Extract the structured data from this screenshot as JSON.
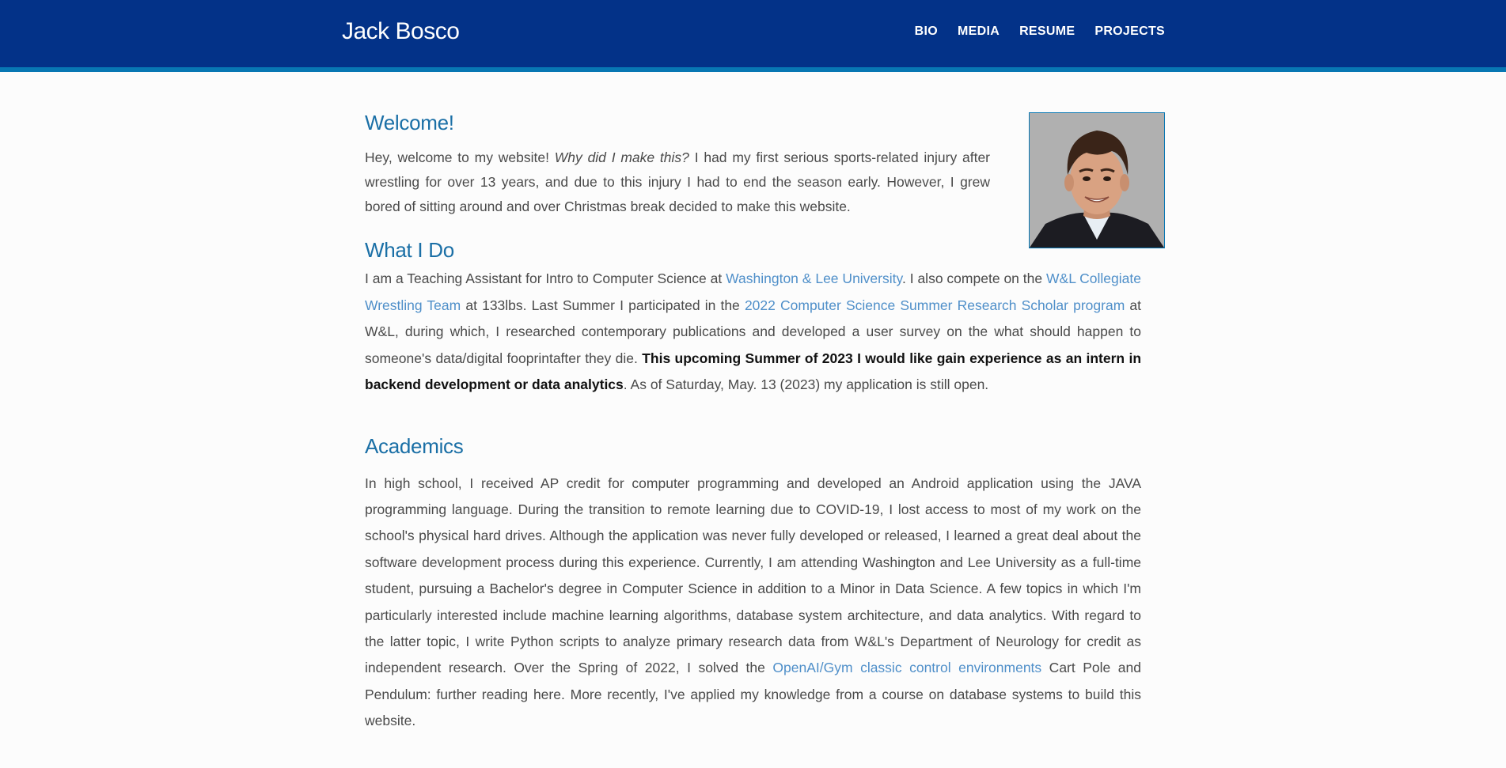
{
  "header": {
    "brand": "Jack Bosco",
    "nav": [
      "BIO",
      "MEDIA",
      "RESUME",
      "PROJECTS"
    ]
  },
  "welcome": {
    "title": "Welcome!",
    "text_1": "Hey, welcome to my website! ",
    "text_em": "Why did I make this?",
    "text_2": " I had my first serious sports-related injury after wrestling for over 13 years, and due to this injury I had to end the season early. However, I grew bored of sitting around and over Christmas break decided to make this website."
  },
  "what_i_do": {
    "title": "What I Do",
    "t1": "I am a Teaching Assistant for Intro to Computer Science at ",
    "link_wlu": "Washington & Lee University",
    "t2": ". I also compete on the ",
    "link_wrestling": "W&L Collegiate Wrestling Team",
    "t3": " at 133lbs. Last Summer I participated in the ",
    "link_research": "2022 Computer Science Summer Research Scholar program",
    "t4": " at W&L, during which, I researched contemporary publications and developed a user survey on the what should happen to someone's data/digital fooprintafter they die. ",
    "bold": "This upcoming Summer of 2023 I would like gain experience as an intern in backend development or data analytics",
    "t5": ". As of Saturday, May. 13 (2023) my application is still open."
  },
  "academics": {
    "title": "Academics",
    "t1": "In high school, I received AP credit for computer programming and developed an Android application using the JAVA programming language. During the transition to remote learning due to COVID-19, I lost access to most of my work on the school's physical hard drives. Although the application was never fully developed or released, I learned a great deal about the software development process during this experience. Currently, I am attending Washington and Lee University as a full-time student, pursuing a Bachelor's degree in Computer Science in addition to a Minor in Data Science. A few topics in which I'm particularly interested include machine learning algorithms, database system architecture, and data analytics. With regard to the latter topic, I write Python scripts to analyze primary research data from W&L's Department of Neurology for credit as independent research. Over the Spring of 2022, I solved the ",
    "link_gym": "OpenAI/Gym classic control environments",
    "t2": " Cart Pole and Pendulum: further reading ",
    "link_here": "here",
    "t3": ". More recently, I've applied my knowledge from a course on database systems to build this website."
  },
  "colors": {
    "header_bg": "#033288",
    "header_stripe": "#0877b3",
    "heading": "#1a6fa6",
    "link": "#4f8fc9"
  },
  "icons": {
    "portrait": "profile-photo"
  }
}
